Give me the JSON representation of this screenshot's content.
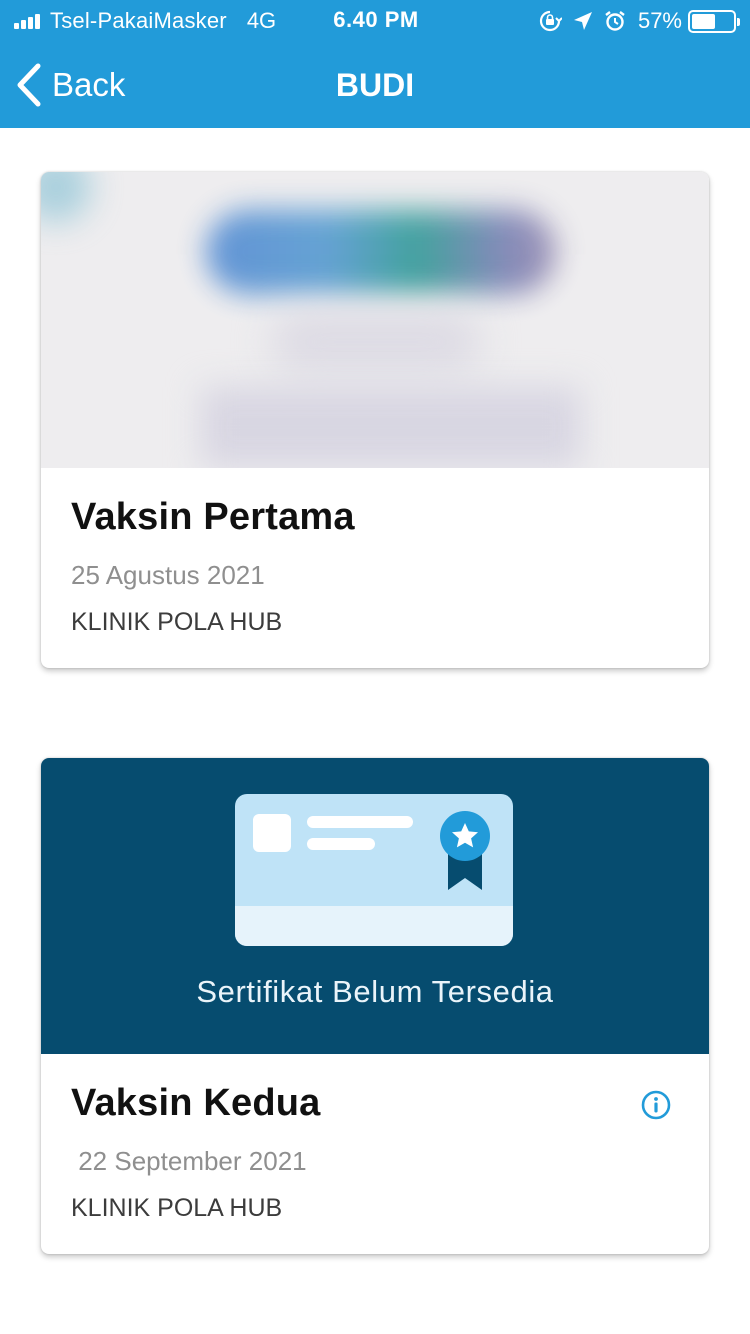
{
  "status_bar": {
    "carrier": "Tsel-PakaiMasker",
    "network": "4G",
    "time": "6.40 PM",
    "battery_percent": "57%",
    "battery_level": 0.57,
    "icons": [
      "signal-icon",
      "orientation-lock-icon",
      "location-arrow-icon",
      "alarm-icon",
      "battery-icon"
    ]
  },
  "nav": {
    "back_label": "Back",
    "title": "BUDI"
  },
  "colors": {
    "header": "#229bd9",
    "cert_placeholder_bg": "#064c6f",
    "info_icon": "#229bd9"
  },
  "vaccines": [
    {
      "title": "Vaksin Pertama",
      "date": "25 Agustus 2021",
      "clinic": "KLINIK POLA HUB",
      "certificate": "blurred-image"
    },
    {
      "title": "Vaksin Kedua",
      "date": " 22 September 2021",
      "clinic": "KLINIK POLA HUB",
      "certificate_status": "Sertifikat Belum Tersedia",
      "has_info": true
    }
  ]
}
